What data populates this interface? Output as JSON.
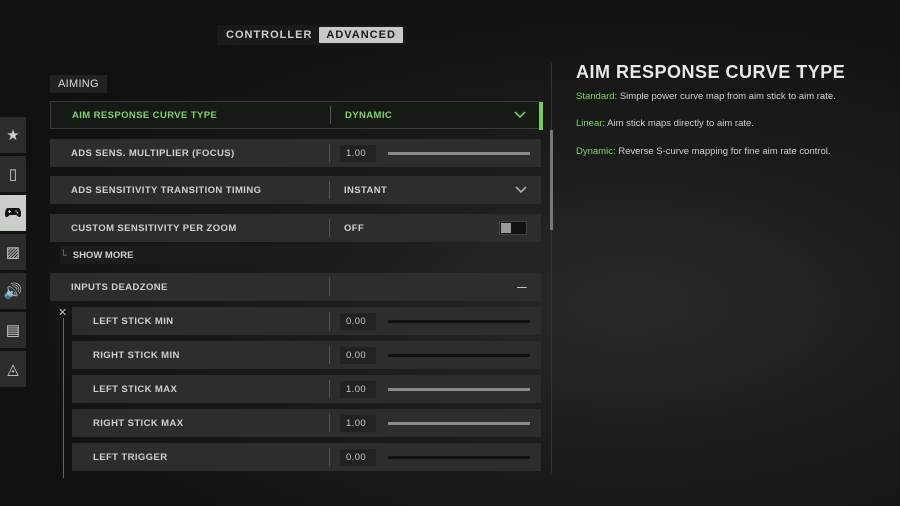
{
  "tabs": [
    {
      "label": "CONTROLLER",
      "active": false
    },
    {
      "label": "ADVANCED",
      "active": true
    }
  ],
  "sidenav": [
    {
      "icon": "star-icon",
      "glyph": "★"
    },
    {
      "icon": "mouse-icon",
      "glyph": "▯"
    },
    {
      "icon": "gamepad-icon",
      "glyph": "🎮",
      "active": true
    },
    {
      "icon": "graphics-icon",
      "glyph": "▨"
    },
    {
      "icon": "audio-icon",
      "glyph": "🔊"
    },
    {
      "icon": "interface-icon",
      "glyph": "▤"
    },
    {
      "icon": "network-icon",
      "glyph": "◬"
    }
  ],
  "section": "AIMING",
  "rows": {
    "aim_curve": {
      "label": "AIM RESPONSE CURVE TYPE",
      "value": "DYNAMIC"
    },
    "ads_mult": {
      "label": "ADS SENS. MULTIPLIER (FOCUS)",
      "value": "1.00",
      "fill": 1.0
    },
    "ads_timing": {
      "label": "ADS SENSITIVITY TRANSITION TIMING",
      "value": "INSTANT"
    },
    "custom_zoom": {
      "label": "CUSTOM SENSITIVITY PER ZOOM",
      "value": "OFF"
    },
    "show_more": "SHOW MORE",
    "deadzone": {
      "label": "INPUTS DEADZONE",
      "toggle": "—"
    }
  },
  "deadzone_items": [
    {
      "label": "LEFT STICK MIN",
      "value": "0.00",
      "fill": 0.0
    },
    {
      "label": "RIGHT STICK MIN",
      "value": "0.00",
      "fill": 0.0
    },
    {
      "label": "LEFT STICK MAX",
      "value": "1.00",
      "fill": 1.0
    },
    {
      "label": "RIGHT STICK MAX",
      "value": "1.00",
      "fill": 1.0
    },
    {
      "label": "LEFT TRIGGER",
      "value": "0.00",
      "fill": 0.0
    }
  ],
  "info": {
    "title": "AIM RESPONSE CURVE TYPE",
    "lines": [
      {
        "key": "Standard:",
        "text": " Simple power curve map from aim stick to aim rate."
      },
      {
        "key": "Linear:",
        "text": " Aim stick maps directly to aim rate."
      },
      {
        "key": "Dynamic:",
        "text": " Reverse S-curve mapping for fine aim rate control."
      }
    ]
  },
  "colors": {
    "accent": "#6fcf5b"
  }
}
